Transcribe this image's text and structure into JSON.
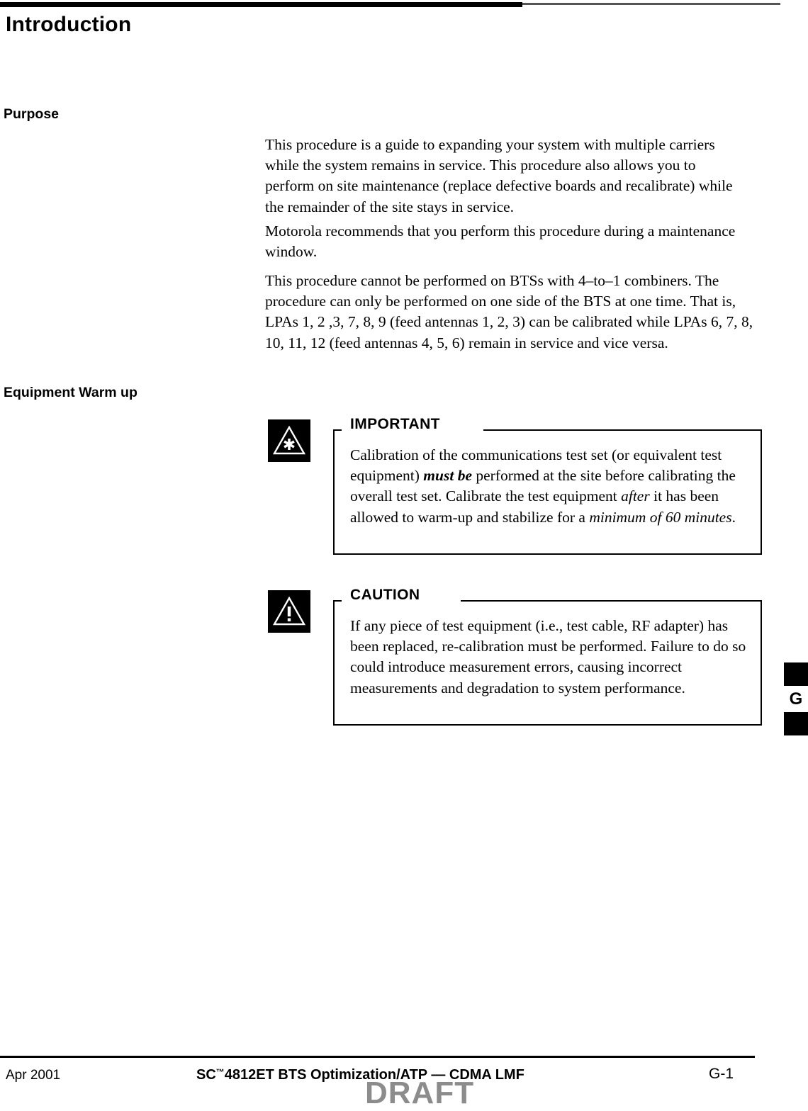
{
  "page": {
    "title": "Introduction",
    "tab_letter": "G"
  },
  "sections": [
    {
      "heading": "Purpose"
    },
    {
      "heading": "Equipment Warm up"
    }
  ],
  "paragraphs": [
    "This procedure is a guide to expanding your system with multiple carriers while the system remains in service. This procedure also allows you to perform on site maintenance (replace defective boards and recalibrate) while the remainder of the site stays in service.",
    "Motorola recommends that you perform this procedure during a maintenance window.",
    "This procedure cannot be performed on BTSs with 4–to–1 combiners. The procedure can only be performed on one side of the BTS at one time. That is, LPAs 1, 2 ,3, 7, 8, 9 (feed antennas 1, 2, 3) can be calibrated while LPAs 6, 7, 8, 10, 11, 12 (feed antennas 4, 5, 6) remain in service and vice versa."
  ],
  "admonitions": [
    {
      "label": "IMPORTANT",
      "icon": "asterisk-triangle-icon",
      "text_parts": [
        {
          "style": "normal",
          "text": "Calibration of the communications test set (or equivalent test equipment) "
        },
        {
          "style": "bold-italic",
          "text": "must be"
        },
        {
          "style": "normal",
          "text": " performed at the site before calibrating the overall test set. Calibrate the test equipment "
        },
        {
          "style": "italic",
          "text": "after"
        },
        {
          "style": "normal",
          "text": " it has been allowed to warm-up and stabilize for a "
        },
        {
          "style": "italic",
          "text": "minimum of 60 minutes"
        },
        {
          "style": "normal",
          "text": "."
        }
      ]
    },
    {
      "label": "CAUTION",
      "icon": "exclamation-triangle-icon",
      "text_parts": [
        {
          "style": "normal",
          "text": "If any piece of test equipment (i.e., test cable, RF adapter) has been replaced, re-calibration must be performed. Failure to do so could introduce measurement errors, causing incorrect measurements and degradation to system performance."
        }
      ]
    }
  ],
  "footer": {
    "date": "Apr 2001",
    "title_prefix": "SC",
    "title_tm": "™",
    "title_suffix": "4812ET BTS Optimization/ATP — CDMA LMF",
    "page_number": "G-1",
    "watermark": "DRAFT"
  },
  "colors": {
    "text": "#000000",
    "watermark": "#8c8c8c",
    "rule_light": "#555555",
    "page_background": "#ffffff"
  }
}
